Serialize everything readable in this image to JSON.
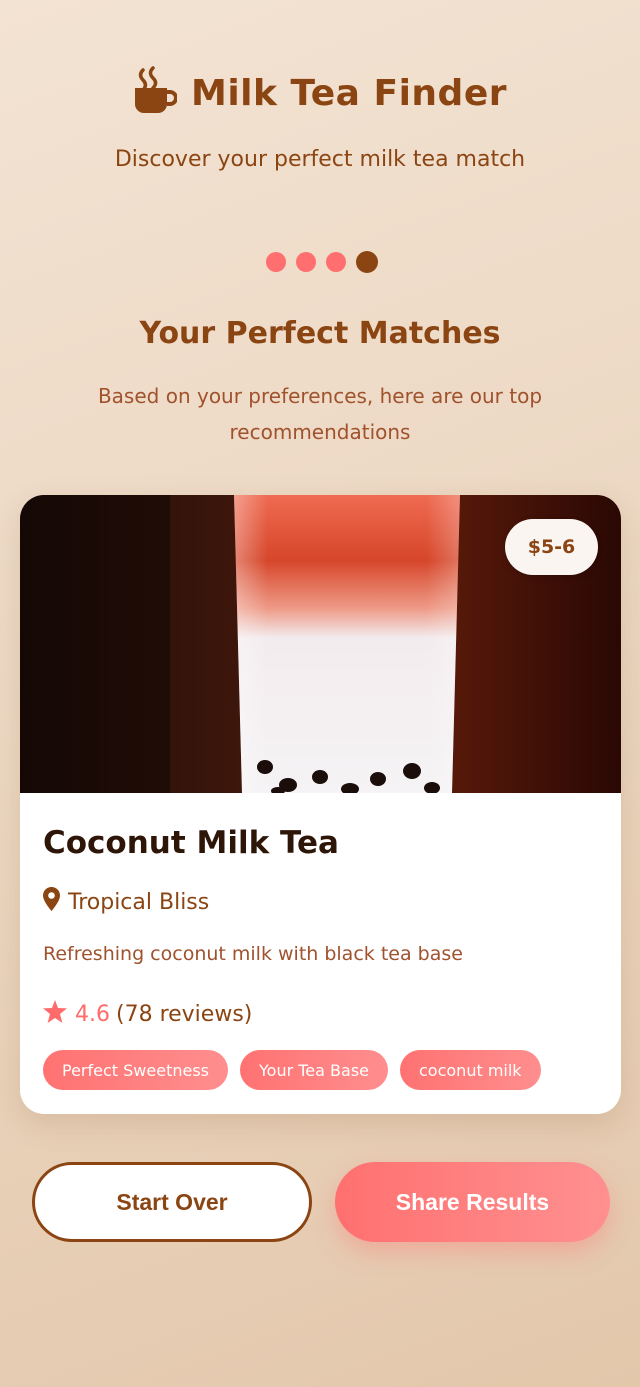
{
  "header": {
    "title": "Milk Tea Finder",
    "subtitle": "Discover your perfect milk tea match",
    "icon": "coffee-cup-icon"
  },
  "progress": {
    "total_steps": 4,
    "current_step": 4
  },
  "results": {
    "heading": "Your Perfect Matches",
    "description": "Based on your preferences, here are our top recommendations"
  },
  "card": {
    "price": "$5-6",
    "name": "Coconut Milk Tea",
    "shop": "Tropical Bliss",
    "description": "Refreshing coconut milk with black tea base",
    "rating": "4.6",
    "reviews": "(78 reviews)",
    "tags": [
      "Perfect Sweetness",
      "Your Tea Base",
      "coconut milk"
    ]
  },
  "actions": {
    "start_over": "Start Over",
    "share": "Share Results"
  },
  "colors": {
    "brand_brown": "#8b4513",
    "accent_coral": "#ff6b6b"
  }
}
